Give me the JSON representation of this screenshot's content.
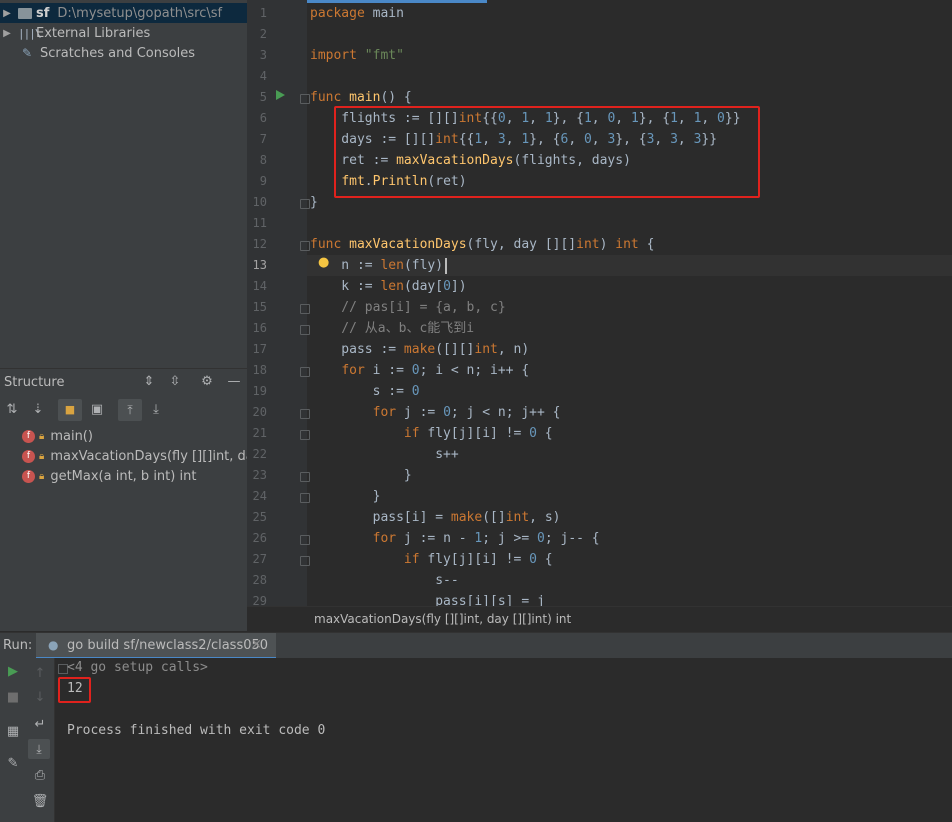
{
  "project": {
    "root_name": "sf",
    "root_path": "D:\\mysetup\\gopath\\src\\sf",
    "external_libraries": "External Libraries",
    "scratches": "Scratches and Consoles"
  },
  "structure": {
    "title": "Structure",
    "items": [
      {
        "label": "main()"
      },
      {
        "label": "maxVacationDays(fly [][]int, day [][]int) int"
      },
      {
        "label": "getMax(a int, b int) int"
      }
    ]
  },
  "editor": {
    "line_numbers": [
      "1",
      "2",
      "3",
      "4",
      "5",
      "6",
      "7",
      "8",
      "9",
      "10",
      "11",
      "12",
      "13",
      "14",
      "15",
      "16",
      "17",
      "18",
      "19",
      "20",
      "21",
      "22",
      "23",
      "24",
      "25",
      "26",
      "27",
      "28",
      "29"
    ],
    "current_line": "13",
    "breadcrumb": "maxVacationDays(fly [][]int, day [][]int) int"
  },
  "run": {
    "label": "Run:",
    "tab_title": "go build sf/newclass2/class050",
    "setup_calls": "<4 go setup calls>",
    "output": "12",
    "finished": "Process finished with exit code 0"
  },
  "colors": {
    "highlight_box": "#e0221d",
    "keyword": "#cc7832",
    "number": "#6897bb",
    "string": "#6a8759",
    "function": "#ffc66d"
  }
}
